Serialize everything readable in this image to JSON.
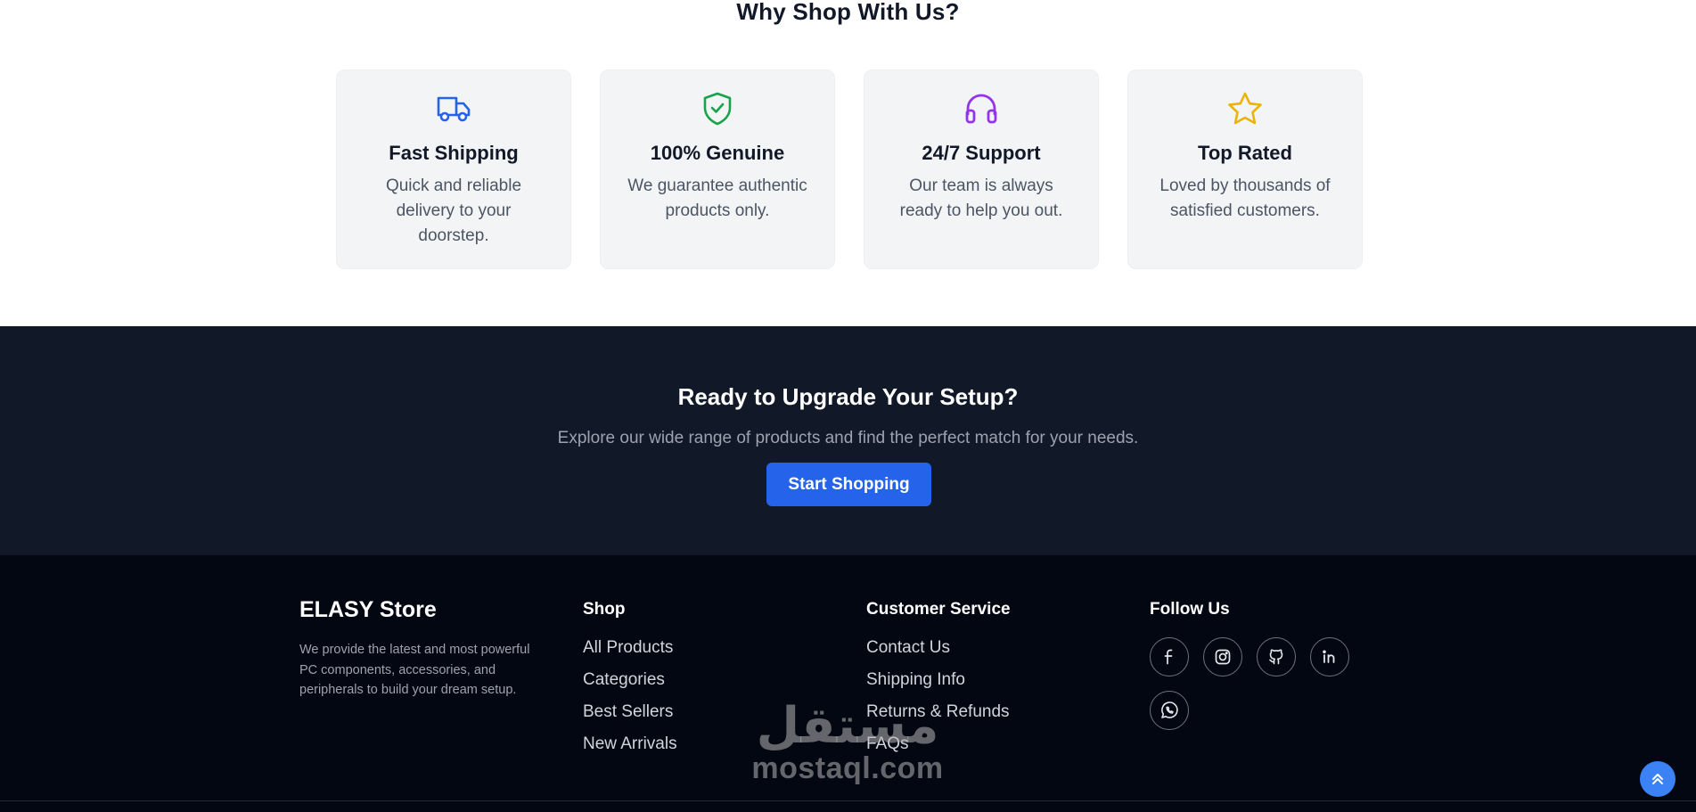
{
  "why": {
    "title": "Why Shop With Us?",
    "features": [
      {
        "icon": "truck-icon",
        "color": "#2563eb",
        "title": "Fast Shipping",
        "desc": "Quick and reliable delivery to your doorstep."
      },
      {
        "icon": "shield-check-icon",
        "color": "#16a34a",
        "title": "100% Genuine",
        "desc": "We guarantee authentic products only."
      },
      {
        "icon": "headphones-icon",
        "color": "#9333ea",
        "title": "24/7 Support",
        "desc": "Our team is always ready to help you out."
      },
      {
        "icon": "star-icon",
        "color": "#eab308",
        "title": "Top Rated",
        "desc": "Loved by thousands of satisfied customers."
      }
    ]
  },
  "cta": {
    "title": "Ready to Upgrade Your Setup?",
    "subtitle": "Explore our wide range of products and find the perfect match for your needs.",
    "button": "Start Shopping"
  },
  "footer": {
    "brand": "ELASY Store",
    "description": "We provide the latest and most powerful PC components, accessories, and peripherals to build your dream setup.",
    "shop": {
      "title": "Shop",
      "links": [
        "All Products",
        "Categories",
        "Best Sellers",
        "New Arrivals"
      ]
    },
    "service": {
      "title": "Customer Service",
      "links": [
        "Contact Us",
        "Shipping Info",
        "Returns & Refunds",
        "FAQs"
      ]
    },
    "follow": {
      "title": "Follow Us",
      "icons": [
        "facebook-icon",
        "instagram-icon",
        "github-icon",
        "linkedin-icon",
        "whatsapp-icon"
      ]
    }
  },
  "watermark": {
    "arabic": "مستقل",
    "latin": "mostaql.com"
  },
  "colors": {
    "primary": "#2563eb",
    "cta_bg": "#111827",
    "footer_bg": "#030712"
  }
}
